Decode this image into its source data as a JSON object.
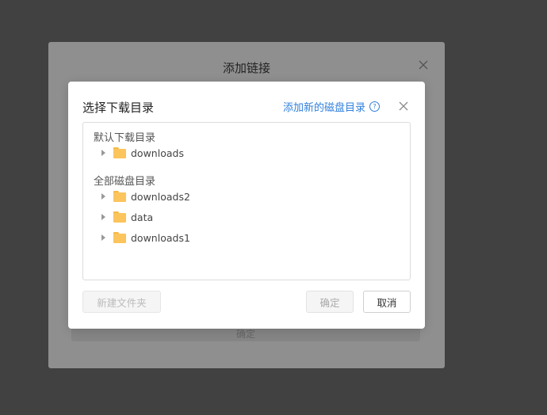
{
  "background_dialog": {
    "title": "添加链接",
    "footer_text": "确定"
  },
  "modal": {
    "title": "选择下载目录",
    "add_dir_link": "添加新的磁盘目录",
    "help_icon": "?",
    "default_section_label": "默认下载目录",
    "default_items": [
      {
        "label": "downloads"
      }
    ],
    "all_section_label": "全部磁盘目录",
    "all_items": [
      {
        "label": "downloads2"
      },
      {
        "label": "data"
      },
      {
        "label": "downloads1"
      }
    ],
    "new_folder_button": "新建文件夹",
    "ok_button": "确定",
    "cancel_button": "取消"
  },
  "colors": {
    "accent": "#2f7fdc",
    "folder": "#fcc45d",
    "backdrop": "#414141"
  },
  "icons": [
    "close-icon",
    "help-icon",
    "caret-right-icon",
    "folder-icon"
  ]
}
